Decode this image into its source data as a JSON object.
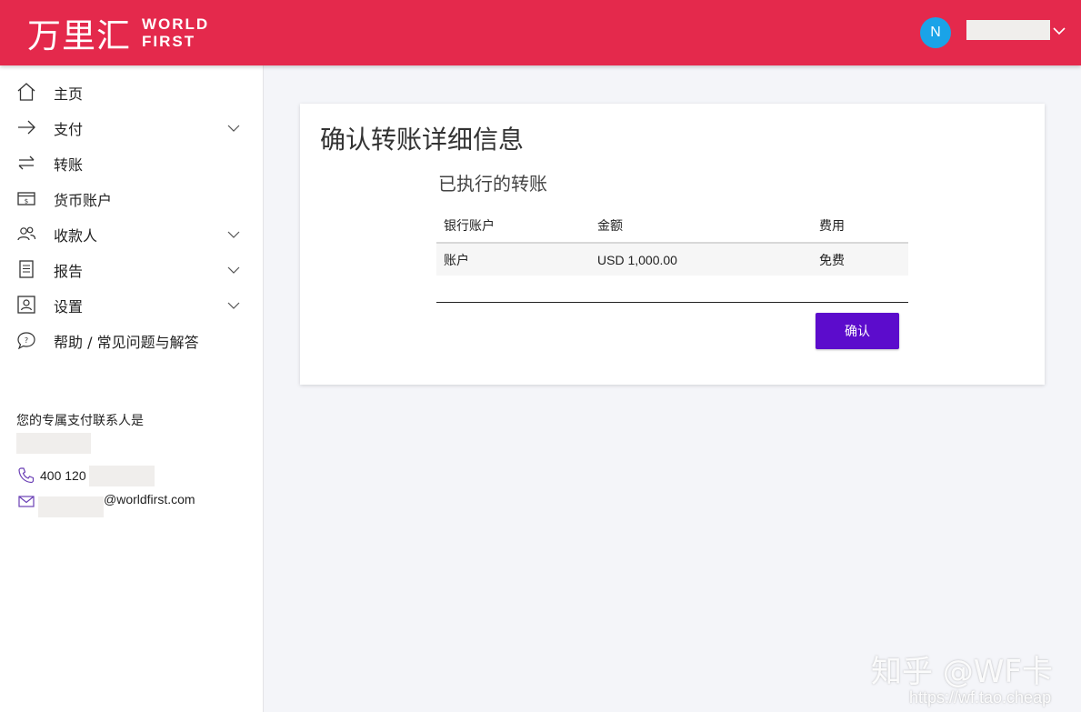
{
  "header": {
    "logo_cn": "万里汇",
    "logo_en_line1": "WORLD",
    "logo_en_line2": "FIRST",
    "avatar_initial": "N",
    "brand_color": "#e4294c"
  },
  "sidebar": {
    "items": [
      {
        "label": "主页",
        "icon": "home-icon",
        "expandable": false
      },
      {
        "label": "支付",
        "icon": "arrow-right-icon",
        "expandable": true
      },
      {
        "label": "转账",
        "icon": "transfer-arrows-icon",
        "expandable": false
      },
      {
        "label": "货币账户",
        "icon": "wallet-icon",
        "expandable": false
      },
      {
        "label": "收款人",
        "icon": "users-icon",
        "expandable": true
      },
      {
        "label": "报告",
        "icon": "report-icon",
        "expandable": true
      },
      {
        "label": "设置",
        "icon": "profile-card-icon",
        "expandable": true
      },
      {
        "label": "帮助 / 常见问题与解答",
        "icon": "chat-bubble-icon",
        "expandable": false
      }
    ],
    "contact": {
      "title": "您的专属支付联系人是",
      "phone_prefix": "400 120",
      "email_domain": "@worldfirst.com"
    }
  },
  "main": {
    "page_title": "确认转账详细信息",
    "section_title": "已执行的转账",
    "table": {
      "columns": [
        "银行账户",
        "金额",
        "费用"
      ],
      "rows": [
        [
          "账户",
          "USD 1,000.00",
          "免费"
        ]
      ]
    },
    "confirm_label": "确认",
    "accent_color": "#5c0ccc"
  },
  "watermark": {
    "text": "知乎 @WF卡",
    "url": "https://wf.tao.cheap"
  }
}
